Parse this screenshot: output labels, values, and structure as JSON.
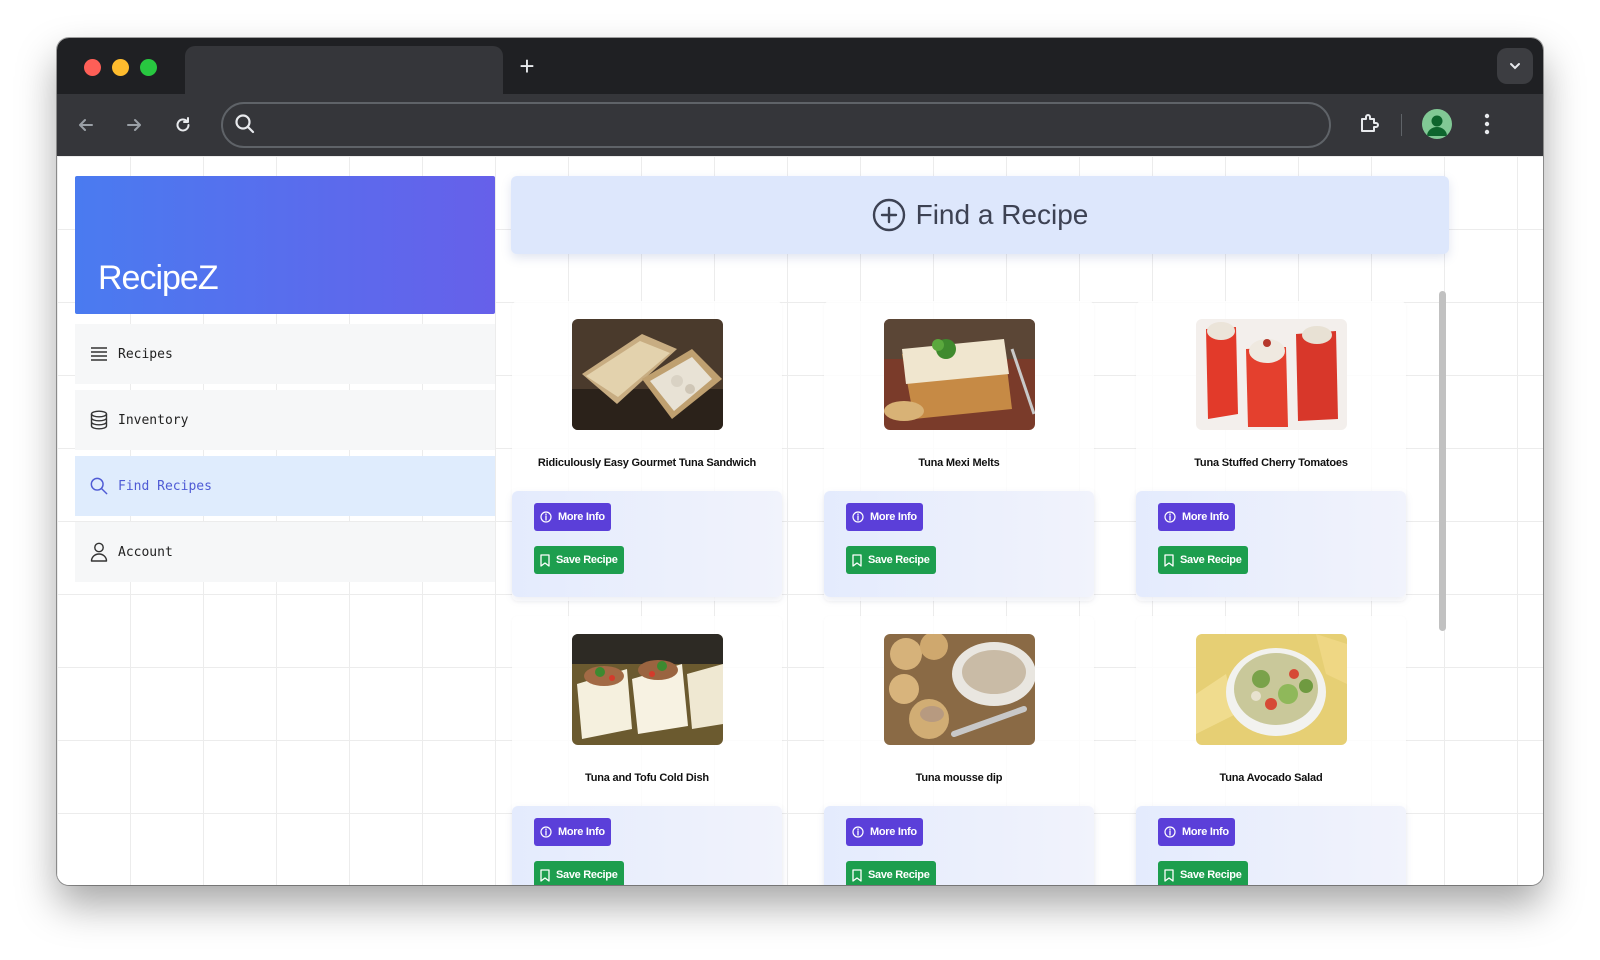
{
  "browser": {
    "new_tab_label": "+",
    "address_value": ""
  },
  "app": {
    "brand": "RecipeZ",
    "nav": [
      {
        "label": "Recipes",
        "icon": "list-icon",
        "active": false
      },
      {
        "label": "Inventory",
        "icon": "database-icon",
        "active": false
      },
      {
        "label": "Find Recipes",
        "icon": "search-icon",
        "active": true
      },
      {
        "label": "Account",
        "icon": "user-icon",
        "active": false
      }
    ],
    "header": {
      "title": "Find a Recipe",
      "icon": "plus-circle-icon"
    },
    "recipes": [
      {
        "name": "Ridiculously Easy Gourmet Tuna Sandwich",
        "image": "tuna-sandwich-photo"
      },
      {
        "name": "Tuna Mexi Melts",
        "image": "mexi-melts-photo"
      },
      {
        "name": "Tuna Stuffed Cherry Tomatoes",
        "image": "stuffed-tomatoes-photo"
      },
      {
        "name": "Tuna and Tofu Cold Dish",
        "image": "tofu-dish-photo"
      },
      {
        "name": "Tuna mousse dip",
        "image": "mousse-dip-photo"
      },
      {
        "name": "Tuna Avocado Salad",
        "image": "avocado-salad-photo"
      }
    ],
    "buttons": {
      "more_info": "More Info",
      "save_recipe": "Save Recipe"
    }
  },
  "colors": {
    "brand_gradient_start": "#4a7bf0",
    "brand_gradient_end": "#6660ea",
    "more_info_button": "#5b3fd9",
    "save_button": "#1d9e4e",
    "active_nav_bg": "#dfecfd"
  }
}
